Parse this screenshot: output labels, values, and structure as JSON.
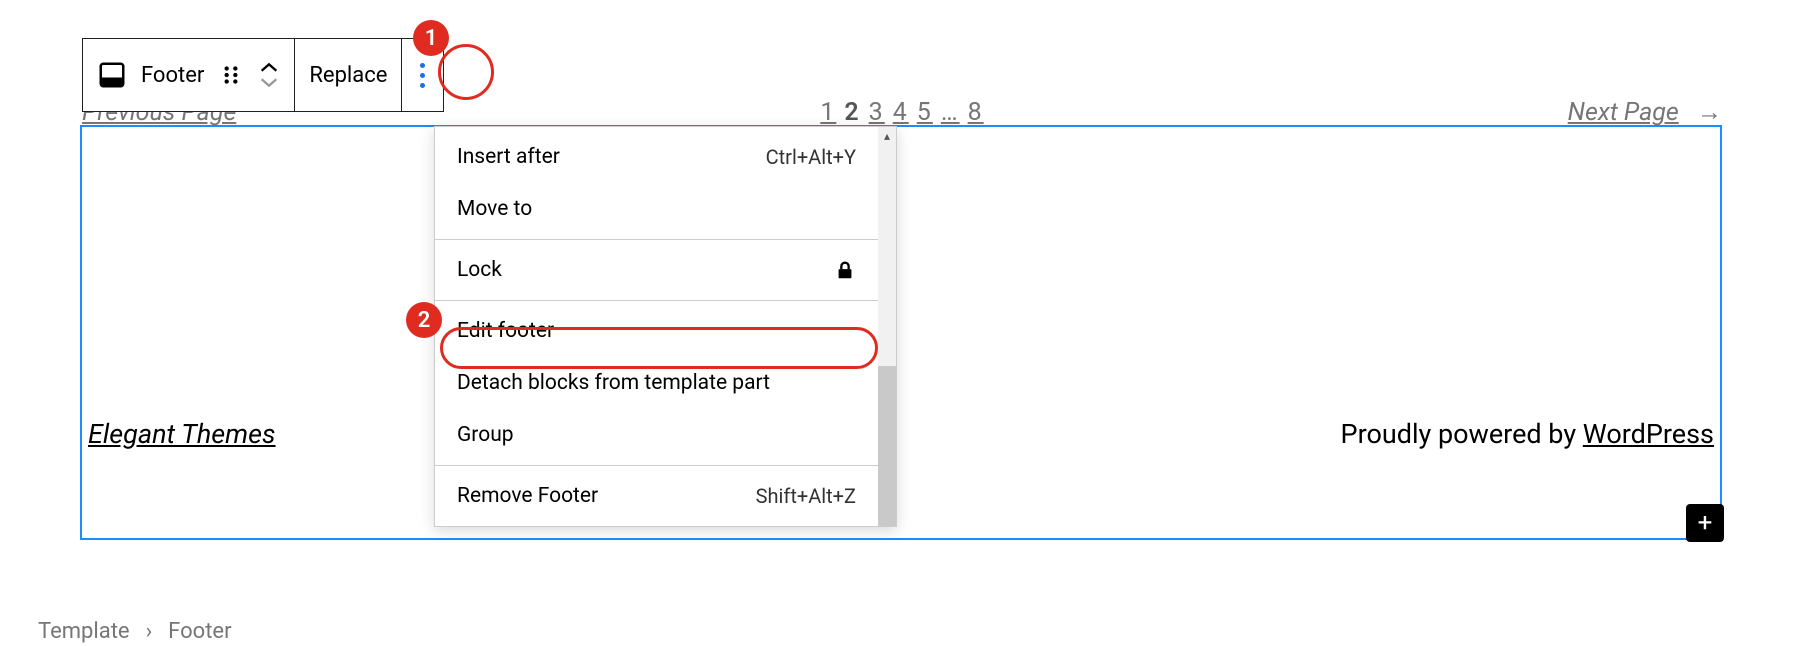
{
  "toolbar": {
    "block_label": "Footer",
    "replace_label": "Replace"
  },
  "callouts": {
    "one": "1",
    "two": "2"
  },
  "page_nav": {
    "prev_label": "Previous Page",
    "numbers": [
      "1",
      "2",
      "3",
      "4",
      "5",
      "…",
      "8"
    ],
    "next_label": "Next Page",
    "next_arrow": "→"
  },
  "footer": {
    "brand": "Elegant Themes",
    "credit_prefix": "Proudly powered by ",
    "credit_link": "WordPress"
  },
  "menu": {
    "groups": [
      [
        {
          "label": "Insert after",
          "shortcut": "Ctrl+Alt+Y"
        },
        {
          "label": "Move to",
          "shortcut": ""
        }
      ],
      [
        {
          "label": "Lock",
          "shortcut": "",
          "icon": "lock"
        }
      ],
      [
        {
          "label": "Edit footer",
          "shortcut": ""
        },
        {
          "label": "Detach blocks from template part",
          "shortcut": ""
        },
        {
          "label": "Group",
          "shortcut": ""
        }
      ],
      [
        {
          "label": "Remove Footer",
          "shortcut": "Shift+Alt+Z"
        }
      ]
    ]
  },
  "breadcrumb": {
    "root": "Template",
    "sep": "›",
    "leaf": "Footer"
  }
}
